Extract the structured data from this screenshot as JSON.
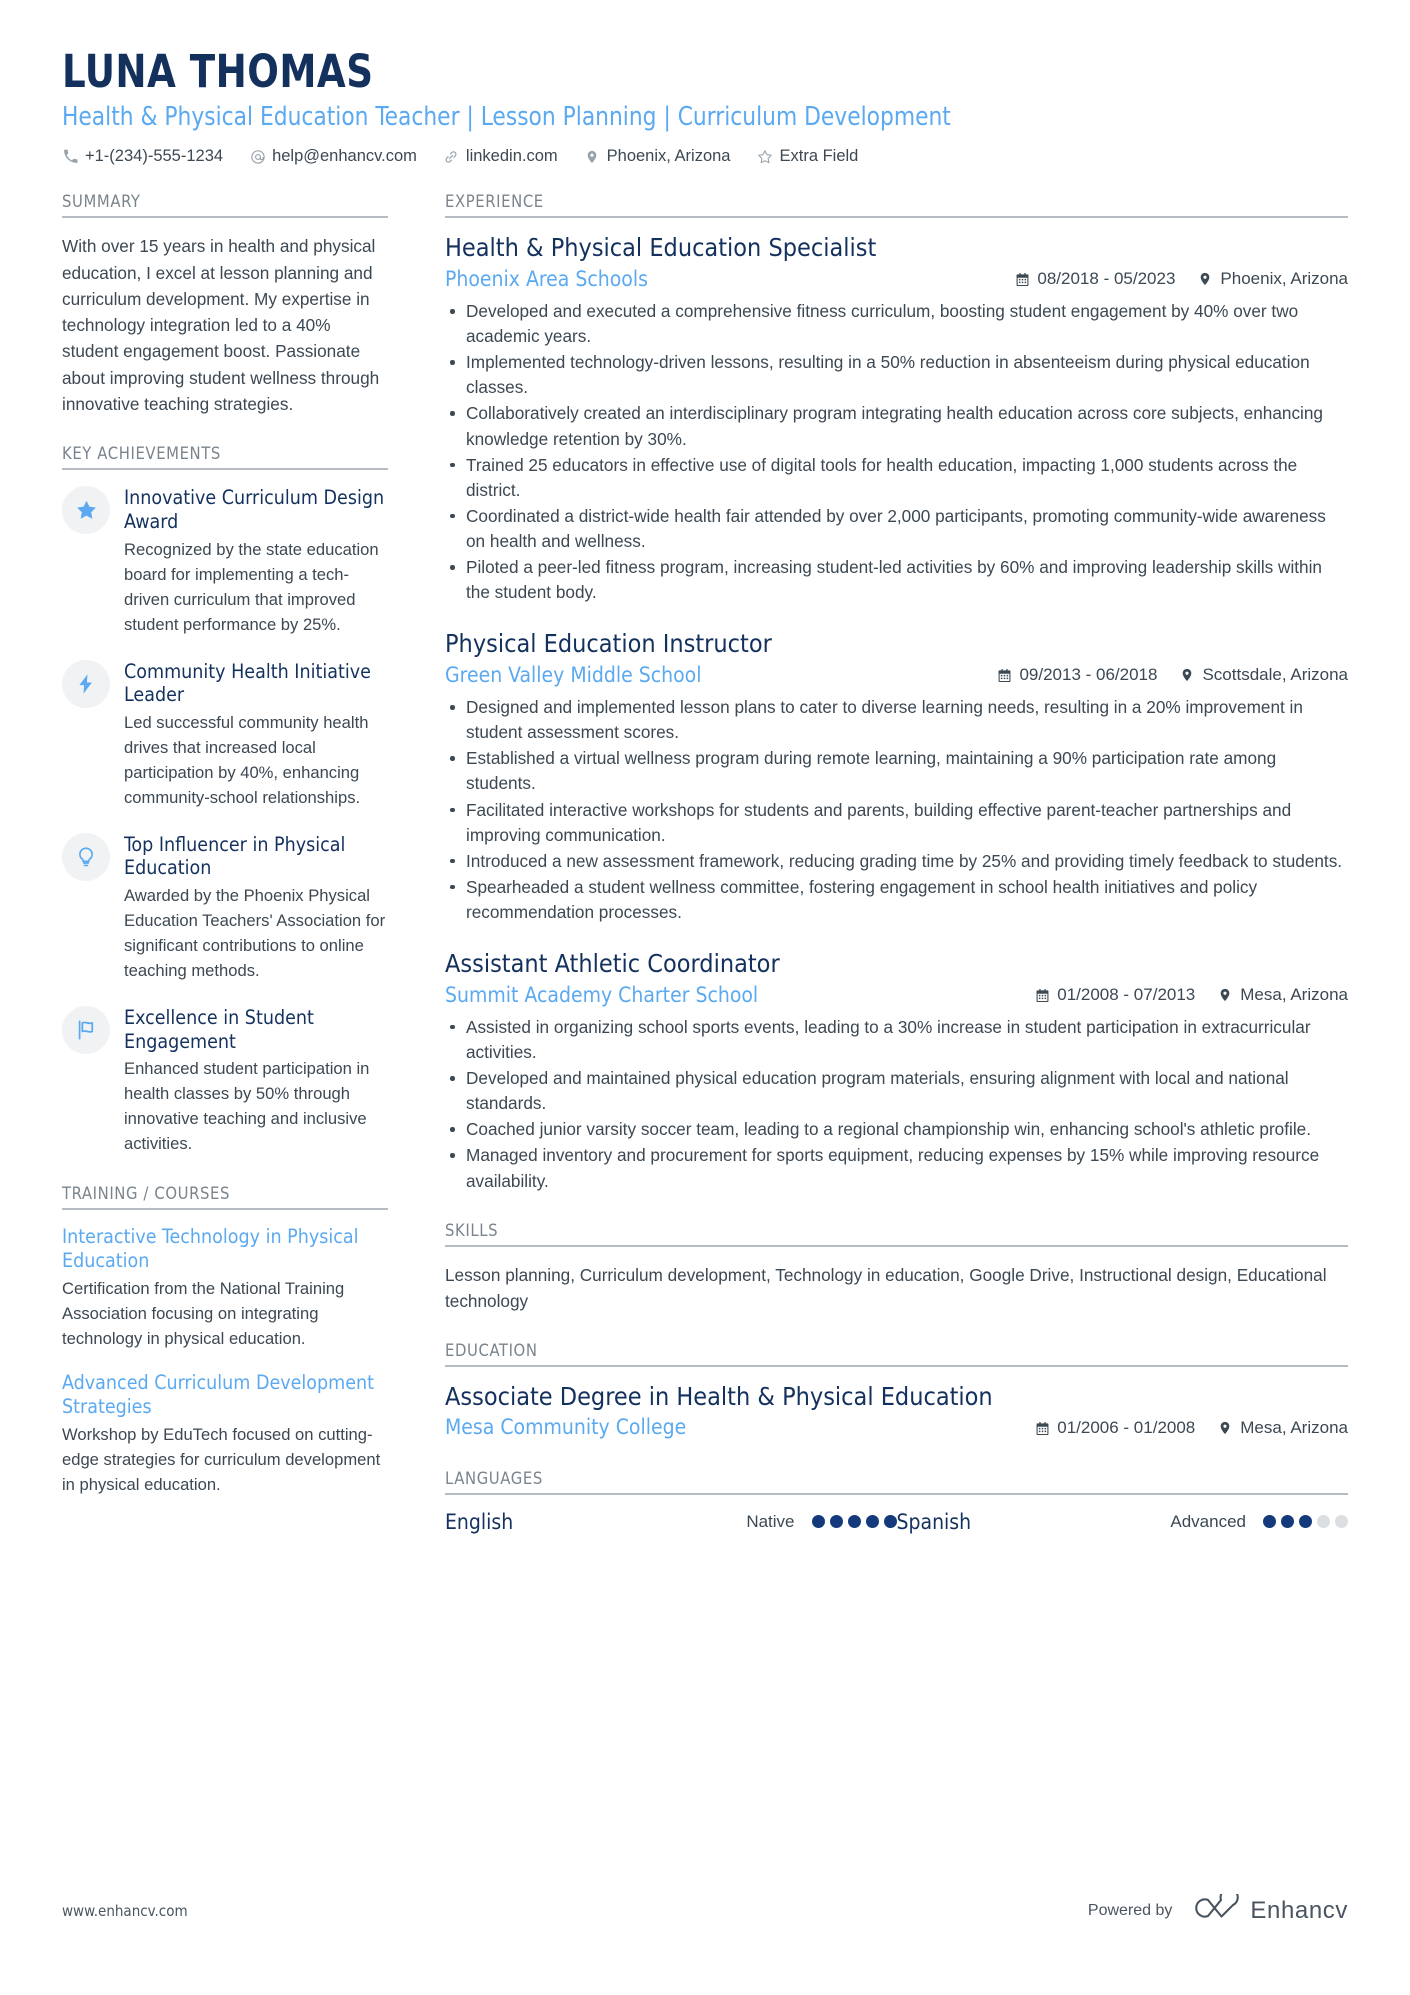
{
  "header": {
    "name": "LUNA THOMAS",
    "headline": "Health & Physical Education Teacher | Lesson Planning | Curriculum Development",
    "contacts": [
      {
        "icon": "phone-icon",
        "text": "+1-(234)-555-1234"
      },
      {
        "icon": "email-icon",
        "text": "help@enhancv.com"
      },
      {
        "icon": "link-icon",
        "text": "linkedin.com"
      },
      {
        "icon": "location-pin-icon",
        "text": "Phoenix, Arizona"
      },
      {
        "icon": "star-outline-icon",
        "text": "Extra Field"
      }
    ]
  },
  "sidebar": {
    "summary": {
      "title": "SUMMARY",
      "text": "With over 15 years in health and physical education, I excel at lesson planning and curriculum development. My expertise in technology integration led to a 40% student engagement boost. Passionate about improving student wellness through innovative teaching strategies."
    },
    "achievements": {
      "title": "KEY ACHIEVEMENTS",
      "items": [
        {
          "icon": "star-icon",
          "title": "Innovative Curriculum Design Award",
          "description": "Recognized by the state education board for implementing a tech-driven curriculum that improved student performance by 25%."
        },
        {
          "icon": "lightning-bolt-icon",
          "title": "Community Health Initiative Leader",
          "description": "Led successful community health drives that increased local participation by 40%, enhancing community-school relationships."
        },
        {
          "icon": "lightbulb-icon",
          "title": "Top Influencer in Physical Education",
          "description": "Awarded by the Phoenix Physical Education Teachers' Association for significant contributions to online teaching methods."
        },
        {
          "icon": "flag-icon",
          "title": "Excellence in Student Engagement",
          "description": "Enhanced student participation in health classes by 50% through innovative teaching and inclusive activities."
        }
      ]
    },
    "training": {
      "title": "TRAINING / COURSES",
      "items": [
        {
          "title": "Interactive Technology in Physical Education",
          "description": "Certification from the National Training Association focusing on integrating technology in physical education."
        },
        {
          "title": "Advanced Curriculum Development Strategies",
          "description": "Workshop by EduTech focused on cutting-edge strategies for curriculum development in physical education."
        }
      ]
    }
  },
  "main": {
    "experience": {
      "title": "EXPERIENCE",
      "jobs": [
        {
          "position": "Health & Physical Education Specialist",
          "company": "Phoenix Area Schools",
          "dates": "08/2018 - 05/2023",
          "location": "Phoenix, Arizona",
          "bullets": [
            "Developed and executed a comprehensive fitness curriculum, boosting student engagement by 40% over two academic years.",
            "Implemented technology-driven lessons, resulting in a 50% reduction in absenteeism during physical education classes.",
            "Collaboratively created an interdisciplinary program integrating health education across core subjects, enhancing knowledge retention by 30%.",
            "Trained 25 educators in effective use of digital tools for health education, impacting 1,000 students across the district.",
            "Coordinated a district-wide health fair attended by over 2,000 participants, promoting community-wide awareness on health and wellness.",
            "Piloted a peer-led fitness program, increasing student-led activities by 60% and improving leadership skills within the student body."
          ]
        },
        {
          "position": "Physical Education Instructor",
          "company": "Green Valley Middle School",
          "dates": "09/2013 - 06/2018",
          "location": "Scottsdale, Arizona",
          "bullets": [
            "Designed and implemented lesson plans to cater to diverse learning needs, resulting in a 20% improvement in student assessment scores.",
            "Established a virtual wellness program during remote learning, maintaining a 90% participation rate among students.",
            "Facilitated interactive workshops for students and parents, building effective parent-teacher partnerships and improving communication.",
            "Introduced a new assessment framework, reducing grading time by 25% and providing timely feedback to students.",
            "Spearheaded a student wellness committee, fostering engagement in school health initiatives and policy recommendation processes."
          ]
        },
        {
          "position": "Assistant Athletic Coordinator",
          "company": "Summit Academy Charter School",
          "dates": "01/2008 - 07/2013",
          "location": "Mesa, Arizona",
          "bullets": [
            "Assisted in organizing school sports events, leading to a 30% increase in student participation in extracurricular activities.",
            "Developed and maintained physical education program materials, ensuring alignment with local and national standards.",
            "Coached junior varsity soccer team, leading to a regional championship win, enhancing school's athletic profile.",
            "Managed inventory and procurement for sports equipment, reducing expenses by 15% while improving resource availability."
          ]
        }
      ]
    },
    "skills": {
      "title": "SKILLS",
      "text": "Lesson planning, Curriculum development, Technology in education, Google Drive, Instructional design, Educational technology"
    },
    "education": {
      "title": "EDUCATION",
      "items": [
        {
          "degree": "Associate Degree in Health & Physical Education",
          "school": "Mesa Community College",
          "dates": "01/2006 - 01/2008",
          "location": "Mesa, Arizona"
        }
      ]
    },
    "languages": {
      "title": "LANGUAGES",
      "items": [
        {
          "name": "English",
          "level": "Native",
          "filled": 5,
          "total": 5
        },
        {
          "name": "Spanish",
          "level": "Advanced",
          "filled": 3,
          "total": 5
        }
      ]
    }
  },
  "footer": {
    "url": "www.enhancv.com",
    "powered_label": "Powered by",
    "brand": "Enhancv"
  },
  "colors": {
    "navy": "#14315e",
    "light_blue": "#5ba9f0",
    "body_text": "#3c4852",
    "muted": "#7a848c",
    "rule": "#b6bcc2",
    "dot_on": "#143a7b",
    "dot_off": "#dcdfe2"
  }
}
